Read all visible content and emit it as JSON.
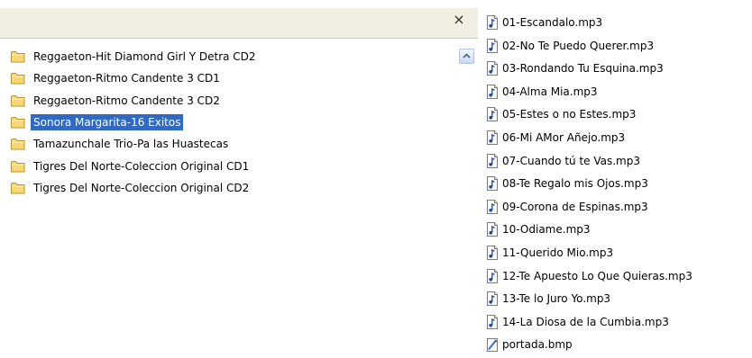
{
  "folder_pane": {
    "close_label": "×",
    "folders": [
      {
        "label": "Reggaeton-Hit Diamond Girl Y Detra CD2",
        "selected": false
      },
      {
        "label": "Reggaeton-Ritmo Candente 3 CD1",
        "selected": false
      },
      {
        "label": "Reggaeton-Ritmo Candente 3 CD2",
        "selected": false
      },
      {
        "label": "Sonora Margarita-16 Exitos",
        "selected": true
      },
      {
        "label": "Tamazunchale Trio-Pa las Huastecas",
        "selected": false
      },
      {
        "label": "Tigres Del Norte-Coleccion Original CD1",
        "selected": false
      },
      {
        "label": "Tigres Del Norte-Coleccion Original CD2",
        "selected": false
      }
    ]
  },
  "file_list": {
    "files": [
      {
        "label": "01-Escandalo.mp3",
        "icon": "audio-file-icon"
      },
      {
        "label": "02-No Te Puedo Querer.mp3",
        "icon": "audio-file-icon"
      },
      {
        "label": "03-Rondando Tu Esquina.mp3",
        "icon": "audio-file-icon"
      },
      {
        "label": "04-Alma Mia.mp3",
        "icon": "audio-file-icon"
      },
      {
        "label": "05-Estes o no Estes.mp3",
        "icon": "audio-file-icon"
      },
      {
        "label": "06-Mi AMor Añejo.mp3",
        "icon": "audio-file-icon"
      },
      {
        "label": "07-Cuando tú te Vas.mp3",
        "icon": "audio-file-icon"
      },
      {
        "label": "08-Te Regalo mis Ojos.mp3",
        "icon": "audio-file-icon"
      },
      {
        "label": "09-Corona de Espinas.mp3",
        "icon": "audio-file-icon"
      },
      {
        "label": "10-Odiame.mp3",
        "icon": "audio-file-icon"
      },
      {
        "label": "11-Querido Mio.mp3",
        "icon": "audio-file-icon"
      },
      {
        "label": "12-Te Apuesto Lo Que Quieras.mp3",
        "icon": "audio-file-icon"
      },
      {
        "label": "13-Te lo Juro Yo.mp3",
        "icon": "audio-file-icon"
      },
      {
        "label": "14-La Diosa de la Cumbia.mp3",
        "icon": "audio-file-icon"
      },
      {
        "label": "portada.bmp",
        "icon": "image-file-icon"
      }
    ]
  },
  "colors": {
    "selection": "#316ac5",
    "folder_yellow": "#f7d775",
    "header_bg": "#f1efe2"
  }
}
